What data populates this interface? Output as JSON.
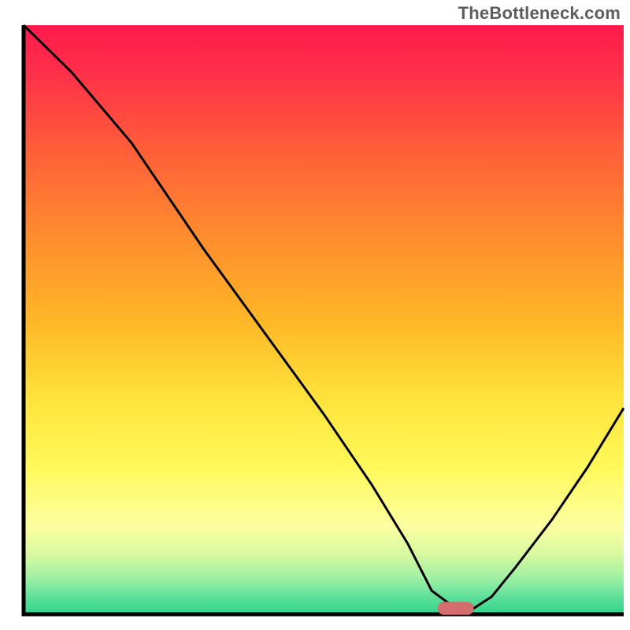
{
  "watermark": "TheBottleneck.com",
  "chart_data": {
    "type": "line",
    "title": "",
    "xlabel": "",
    "ylabel": "",
    "xlim": [
      0,
      100
    ],
    "ylim": [
      0,
      100
    ],
    "grid": false,
    "gradient_stops": [
      {
        "offset": 0.0,
        "color": "#ff1a4b"
      },
      {
        "offset": 0.08,
        "color": "#ff2f4a"
      },
      {
        "offset": 0.2,
        "color": "#ff5a3a"
      },
      {
        "offset": 0.35,
        "color": "#ff8a2e"
      },
      {
        "offset": 0.5,
        "color": "#ffb627"
      },
      {
        "offset": 0.63,
        "color": "#ffe23a"
      },
      {
        "offset": 0.75,
        "color": "#fff95a"
      },
      {
        "offset": 0.85,
        "color": "#fdffa0"
      },
      {
        "offset": 0.9,
        "color": "#d6f9a0"
      },
      {
        "offset": 0.94,
        "color": "#9cf0a5"
      },
      {
        "offset": 0.97,
        "color": "#5fe09a"
      },
      {
        "offset": 1.0,
        "color": "#2fd48a"
      }
    ],
    "curve": {
      "name": "bottleneck-curve",
      "x": [
        0,
        8,
        18,
        22,
        30,
        40,
        50,
        58,
        64,
        68,
        72,
        75,
        78,
        82,
        88,
        94,
        100
      ],
      "y": [
        100,
        92,
        80,
        74,
        62,
        48,
        34,
        22,
        12,
        4,
        1,
        1,
        3,
        8,
        16,
        25,
        35
      ]
    },
    "marker": {
      "name": "optimal-range-marker",
      "x": 72,
      "y": 1,
      "width": 6,
      "height": 2.2,
      "color": "#d46d6d"
    }
  }
}
